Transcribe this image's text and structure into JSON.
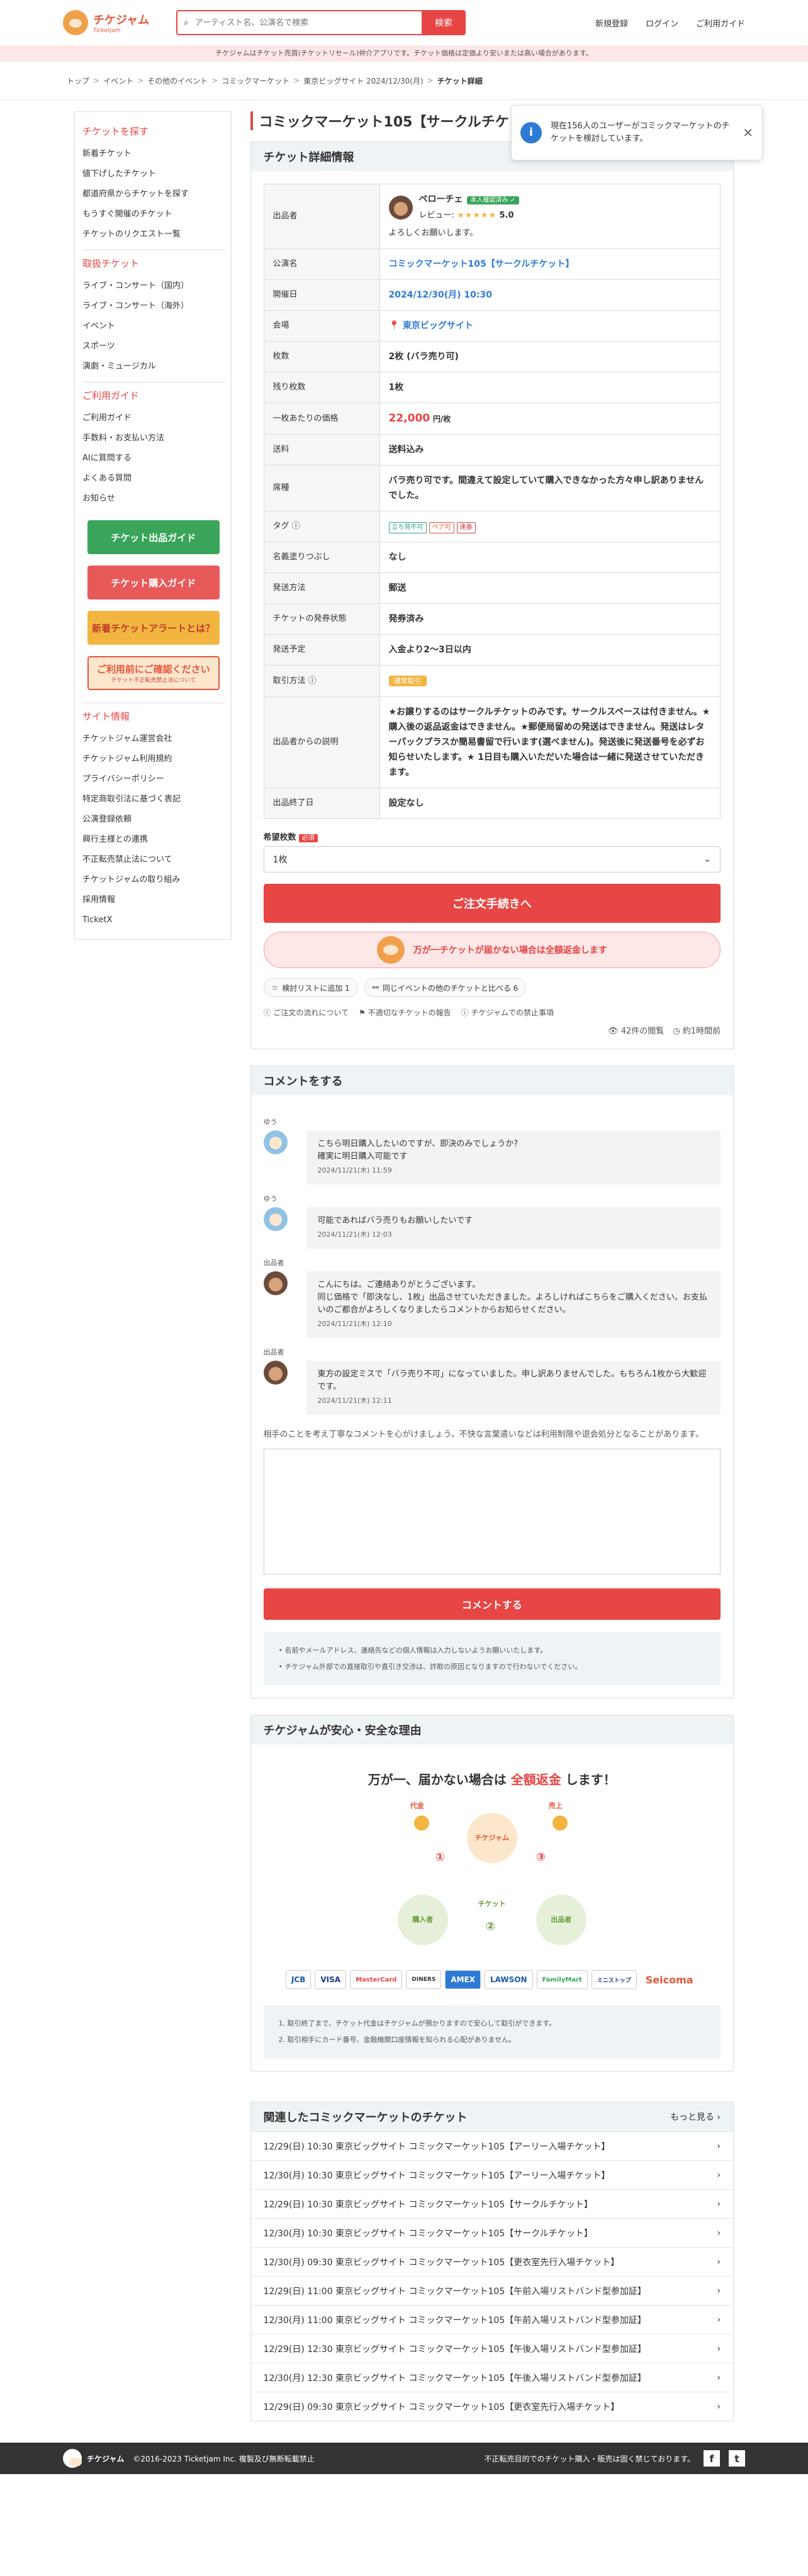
{
  "header": {
    "logo_main": "チケジャム",
    "logo_sub": "Ticketjam",
    "search_placeholder": "アーティスト名、公演名で検索",
    "search_btn": "検索",
    "nav": [
      "新規登録",
      "ログイン",
      "ご利用ガイド"
    ]
  },
  "notice": "チケジャムはチケット売買(チケットリセール)仲介アプリです。チケット価格は定価より安いまたは高い場合があります。",
  "breadcrumb": [
    "トップ",
    "イベント",
    "その他のイベント",
    "コミックマーケット",
    "東京ビッグサイト 2024/12/30(月)",
    "チケット詳細"
  ],
  "sidebar": {
    "h1": "チケットを探す",
    "g1": [
      "新着チケット",
      "値下げしたチケット",
      "都道府県からチケットを探す",
      "もうすぐ開催のチケット",
      "チケットのリクエスト一覧"
    ],
    "h2": "取扱チケット",
    "g2": [
      "ライブ・コンサート（国内）",
      "ライブ・コンサート（海外）",
      "イベント",
      "スポーツ",
      "演劇・ミュージカル"
    ],
    "h3": "ご利用ガイド",
    "g3": [
      "ご利用ガイド",
      "手数料・お支払い方法",
      "AIに質問する",
      "よくある質問",
      "お知らせ"
    ],
    "banners": [
      "チケット出品ガイド",
      "チケット購入ガイド",
      "新着チケットアラートとは？",
      "ご利用前にご確認ください",
      "チケット不正転売禁止法について"
    ],
    "h4": "サイト情報",
    "g4": [
      "チケットジャム運営会社",
      "チケットジャム利用規約",
      "プライバシーポリシー",
      "特定商取引法に基づく表記",
      "公演登録依頼",
      "興行主様との連携",
      "不正転売禁止法について",
      "チケットジャムの取り組み",
      "採用情報",
      "TicketX"
    ]
  },
  "title": "コミックマーケット105【サークルチケット】のチケット",
  "toast": "現在156人のユーザーがコミックマーケットのチケットを検討しています。",
  "detail": {
    "header": "チケット詳細情報",
    "rows": {
      "seller_k": "出品者",
      "seller_name": "ペローチェ",
      "seller_badge": "本人確認済み ✓",
      "review_label": "レビュー:",
      "stars": "★★★★★",
      "rating": "5.0",
      "greeting": "よろしくお願いします。",
      "event_k": "公演名",
      "event_v": "コミックマーケット105【サークルチケット】",
      "date_k": "開催日",
      "date_v": "2024/12/30(月) 10:30",
      "venue_k": "会場",
      "venue_v": "東京ビッグサイト",
      "count_k": "枚数",
      "count_v": "2枚 (バラ売り可)",
      "remain_k": "残り枚数",
      "remain_v": "1枚",
      "price_k": "一枚あたりの価格",
      "price_v": "22,000",
      "price_unit": "円/枚",
      "ship_k": "送料",
      "ship_v": "送料込み",
      "seat_k": "席種",
      "seat_v": "バラ売り可です。間違えて設定していて購入できなかった方々申し訳ありませんでした。",
      "tag_k": "タグ",
      "tags": [
        "立ち見不可",
        "ペア可",
        "連番"
      ],
      "name_k": "名義塗りつぶし",
      "name_v": "なし",
      "method_k": "発送方法",
      "method_v": "郵送",
      "status_k": "チケットの発券状態",
      "status_v": "発券済み",
      "plan_k": "発送予定",
      "plan_v": "入金より2〜3日以内",
      "deal_k": "取引方法",
      "deal_v": "通常取引",
      "desc_k": "出品者からの説明",
      "desc_v": "★お譲りするのはサークルチケットのみです。サークルスペースは付きません。★購入後の返品返金はできません。★郵便局留めの発送はできません。発送はレターパックプラスか簡易書留で行います(選べません)。発送後に発送番号を必ずお知らせいたします。★ 1日目も購入いただいた場合は一緒に発送させていただきます。",
      "end_k": "出品終了日",
      "end_v": "設定なし"
    },
    "qty_label": "希望枚数",
    "req": "必須",
    "qty_value": "1枚",
    "order_btn": "ご注文手続きへ",
    "guarantee": "万が一チケットが届かない場合は全額返金します",
    "fav": "検討リストに追加 1",
    "share": "同じイベントの他のチケットと比べる 6",
    "links": [
      "ご注文の流れについて",
      "不適切なチケットの報告",
      "チケジャムでの禁止事項"
    ],
    "views": "42件の閲覧",
    "updated": "約1時間前"
  },
  "comments": {
    "header": "コメントをする",
    "items": [
      {
        "name": "ゆう",
        "text": "こちら明日購入したいのですが、即決のみでしょうか?\n確実に明日購入可能です",
        "time": "2024/11/21(木) 11:59"
      },
      {
        "name": "ゆう",
        "text": "可能であればバラ売りもお願いしたいです",
        "time": "2024/11/21(木) 12:03"
      },
      {
        "name": "出品者",
        "text": "こんにちは。ご連絡ありがとうございます。\n同じ価格で「即決なし、1枚」出品させていただきました。よろしければこちらをご購入ください。お支払いのご都合がよろしくなりましたらコメントからお知らせください。",
        "time": "2024/11/21(木) 12:10"
      },
      {
        "name": "出品者",
        "text": "東方の設定ミスで「バラ売り不可」になっていました。申し訳ありませんでした。もちろん1枚から大歓迎です。",
        "time": "2024/11/21(木) 12:11"
      }
    ],
    "guide": "相手のことを考え丁寧なコメントを心がけましょう。不快な言葉遣いなどは利用制限や退会処分となることがあります。",
    "submit": "コメントする",
    "notes": [
      "名前やメールアドレス、連絡先などの個人情報は入力しないようお願いいたします。",
      "チケジャム外部での直接取引や直引き交渉は、詐欺の原因となりますので行わないでください。"
    ]
  },
  "safe": {
    "header": "チケジャムが安心・安全な理由",
    "title_pre": "万が一、届かない場合は",
    "title_em": "全額返金",
    "title_post": "します！",
    "labels": [
      "代金",
      "売上",
      "チケジャム",
      "購入者",
      "出品者",
      "チケット"
    ],
    "cards": [
      "JCB",
      "VISA",
      "MasterCard",
      "DINERS",
      "AMEX",
      "LAWSON",
      "FamilyMart",
      "ミニストップ",
      "Seicoma"
    ],
    "notes": [
      "1. 取引終了まで、チケット代金はチケジャムが預かりますので安心して取引ができます。",
      "2. 取引相手にカード番号、金融機関口座情報を知られる心配がありません。"
    ]
  },
  "related": {
    "header": "関連したコミックマーケットのチケット",
    "more": "もっと見る",
    "items": [
      "12/29(日) 10:30 東京ビッグサイト コミックマーケット105【アーリー入場チケット】",
      "12/30(月) 10:30 東京ビッグサイト コミックマーケット105【アーリー入場チケット】",
      "12/29(日) 10:30 東京ビッグサイト コミックマーケット105【サークルチケット】",
      "12/30(月) 10:30 東京ビッグサイト コミックマーケット105【サークルチケット】",
      "12/30(月) 09:30 東京ビッグサイト コミックマーケット105【更衣室先行入場チケット】",
      "12/29(日) 11:00 東京ビッグサイト コミックマーケット105【午前入場リストバンド型参加証】",
      "12/30(月) 11:00 東京ビッグサイト コミックマーケット105【午前入場リストバンド型参加証】",
      "12/29(日) 12:30 東京ビッグサイト コミックマーケット105【午後入場リストバンド型参加証】",
      "12/30(月) 12:30 東京ビッグサイト コミックマーケット105【午後入場リストバンド型参加証】",
      "12/29(日) 09:30 東京ビッグサイト コミックマーケット105【更衣室先行入場チケット】"
    ]
  },
  "footer": {
    "copy": "©2016-2023 Ticketjam Inc. 複製及び無断転載禁止",
    "right": "不正転売目的でのチケット購入・販売は固く禁じております。",
    "fb": "f",
    "tw": "t"
  }
}
